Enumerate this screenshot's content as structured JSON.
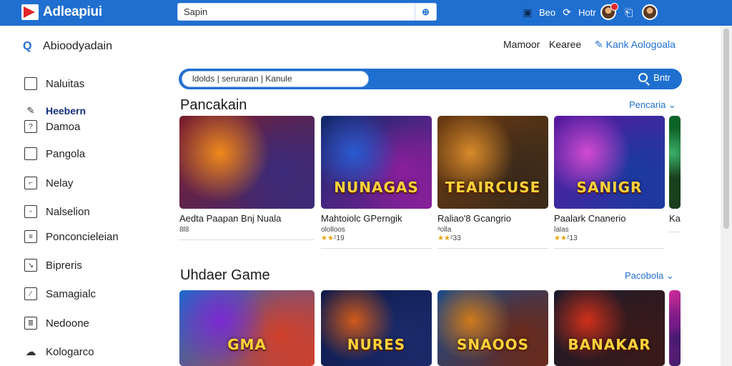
{
  "topbar": {
    "app_title": "Adleapiui",
    "search_placeholder": "Sapin",
    "search_button": "⊕",
    "action1": "Beo",
    "action2": "Hotr"
  },
  "sidebar": {
    "header": "Abioodyadain",
    "items": [
      {
        "label": "Naluitas",
        "icon": "square-icon"
      },
      {
        "label": "Heebern",
        "icon": "edit-icon",
        "active": true
      },
      {
        "label": "Damoa",
        "icon": "doc-icon"
      },
      {
        "label": "Pangola",
        "icon": "bookmark-icon"
      },
      {
        "label": "Nelay",
        "icon": "page-icon"
      },
      {
        "label": "Nalselion",
        "icon": "grid-icon"
      },
      {
        "label": "Ponconcieleian",
        "icon": "list-icon"
      },
      {
        "label": "Bipreris",
        "icon": "chat-icon"
      },
      {
        "label": "Samagialc",
        "icon": "edit-box-icon"
      },
      {
        "label": "Nedoone",
        "icon": "menu-icon"
      },
      {
        "label": "Kologarco",
        "icon": "cloud-icon"
      }
    ]
  },
  "header_links": {
    "link1": "Mamoor",
    "link2": "Kearee",
    "link3": "Kank Aologoala"
  },
  "main_search": {
    "value": "ldolds | seruraran | Kanule",
    "button": "Bntr"
  },
  "sections": [
    {
      "title": "Pancakain",
      "more": "Pencaria ⌄",
      "cards": [
        {
          "name": "Aedta Paapan Bnj Nuala",
          "meta": "8l8",
          "rating": "",
          "art_title": "",
          "colors": [
            "#7a1e2c",
            "#f08a1c",
            "#3a2a7a"
          ]
        },
        {
          "name": "Mahtoiolc GPerngik",
          "meta": "ololloos",
          "rating": "ᶻ19",
          "art_title": "NUNAGAS",
          "colors": [
            "#0e2a6a",
            "#2a5ad0",
            "#8a1f9a"
          ]
        },
        {
          "name": "Raliao'8 Gcangrio",
          "meta": "ᵊolla",
          "rating": "ᶻ33",
          "art_title": "TEAIRCUSE",
          "colors": [
            "#6a3a12",
            "#d88a2a",
            "#3a2a1a"
          ]
        },
        {
          "name": "Paalark Cnanerio",
          "meta": "lalas",
          "rating": "ᶻ13",
          "art_title": "SANIGR",
          "colors": [
            "#5a1aa0",
            "#d24ad0",
            "#1a3aa0"
          ]
        },
        {
          "name": "Ka",
          "meta": "",
          "rating": "",
          "art_title": "",
          "colors": [
            "#0a6a2a",
            "#3ab06a",
            "#1a3a1a"
          ]
        }
      ]
    },
    {
      "title": "Uhdaer Game",
      "more": "Pacobola ⌄",
      "cards": [
        {
          "name": "",
          "meta": "",
          "rating": "",
          "art_title": "GMA",
          "colors": [
            "#1a6ad0",
            "#7a2ad0",
            "#d0402a"
          ]
        },
        {
          "name": "",
          "meta": "",
          "rating": "",
          "art_title": "NURES",
          "colors": [
            "#0e1a4a",
            "#d05a1a",
            "#1a2a6a"
          ]
        },
        {
          "name": "",
          "meta": "",
          "rating": "",
          "art_title": "SNAOOS",
          "colors": [
            "#1a4a8a",
            "#d07a1a",
            "#6a2a1a"
          ]
        },
        {
          "name": "",
          "meta": "",
          "rating": "",
          "art_title": "BANAKAR",
          "colors": [
            "#1a1a2a",
            "#d0301a",
            "#3a1a1a"
          ]
        },
        {
          "name": "",
          "meta": "",
          "rating": "",
          "art_title": "",
          "colors": [
            "#d02a9a",
            "#7a1a8a",
            "#3a1a6a"
          ]
        }
      ]
    }
  ]
}
